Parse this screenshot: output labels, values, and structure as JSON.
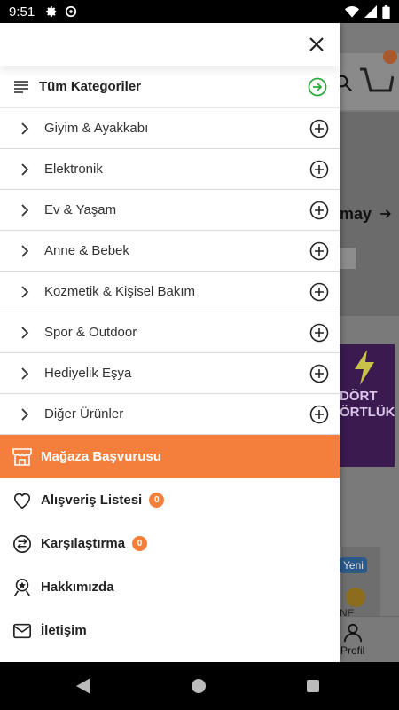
{
  "status_bar": {
    "time": "9:51"
  },
  "background": {
    "banner_text": "may",
    "promo_line1": "DÖRT",
    "promo_line2": "ÖRTLÜK",
    "card_badge": "Yeni",
    "card_text": "NE",
    "profile_label": "Profil"
  },
  "drawer": {
    "all_categories": "Tüm Kategoriler",
    "categories": [
      {
        "label": "Giyim & Ayakkabı"
      },
      {
        "label": "Elektronik"
      },
      {
        "label": "Ev & Yaşam"
      },
      {
        "label": "Anne & Bebek"
      },
      {
        "label": "Kozmetik & Kişisel Bakım"
      },
      {
        "label": "Spor & Outdoor"
      },
      {
        "label": "Hediyelik Eşya"
      },
      {
        "label": "Diğer Ürünler"
      }
    ],
    "store_apply": "Mağaza Başvurusu",
    "menu": {
      "shopping_list": {
        "label": "Alışveriş Listesi",
        "count": "0"
      },
      "compare": {
        "label": "Karşılaştırma",
        "count": "0"
      },
      "about": {
        "label": "Hakkımızda"
      },
      "contact": {
        "label": "İletişim"
      }
    }
  },
  "colors": {
    "accent": "#f47e3c",
    "green": "#2eaa3c"
  }
}
